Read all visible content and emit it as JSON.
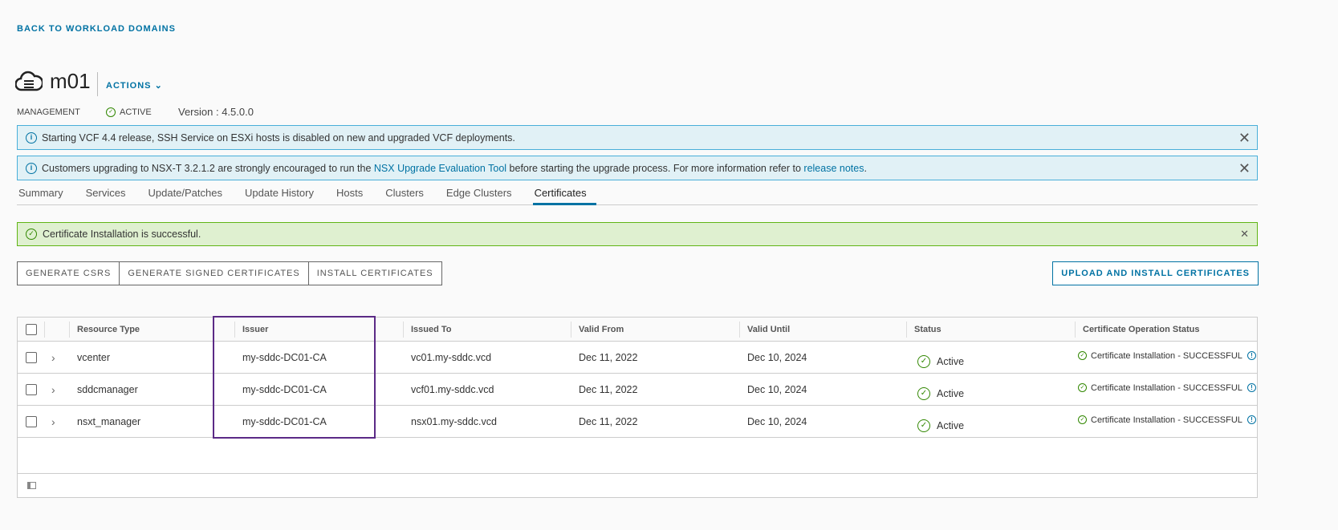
{
  "back_link": "BACK TO WORKLOAD DOMAINS",
  "domain": {
    "name": "m01",
    "actions": "ACTIONS",
    "type": "MANAGEMENT",
    "status": "ACTIVE",
    "version": "Version : 4.5.0.0"
  },
  "banners": [
    {
      "text": "Starting VCF 4.4 release, SSH Service on ESXi hosts is disabled on new and upgraded VCF deployments."
    },
    {
      "text_before": "Customers upgrading to NSX-T 3.2.1.2 are strongly encouraged to run the ",
      "link1": "NSX Upgrade Evaluation Tool",
      "text_middle": " before starting the upgrade process. For more information refer to ",
      "link2": "release notes",
      "text_after": "."
    }
  ],
  "tabs": [
    "Summary",
    "Services",
    "Update/Patches",
    "Update History",
    "Hosts",
    "Clusters",
    "Edge Clusters",
    "Certificates"
  ],
  "success_message": "Certificate Installation is successful.",
  "buttons": {
    "generate_csrs": "GENERATE CSRS",
    "generate_signed": "GENERATE SIGNED CERTIFICATES",
    "install": "INSTALL CERTIFICATES",
    "upload_install": "UPLOAD AND INSTALL CERTIFICATES"
  },
  "table": {
    "columns": [
      "Resource Type",
      "Issuer",
      "Issued To",
      "Valid From",
      "Valid Until",
      "Status",
      "Certificate Operation Status"
    ],
    "rows": [
      {
        "resource": "vcenter",
        "issuer": "my-sddc-DC01-CA",
        "issued_to": "vc01.my-sddc.vcd",
        "valid_from": "Dec 11, 2022",
        "valid_until": "Dec 10, 2024",
        "status": "Active",
        "op_status": "Certificate Installation - SUCCESSFUL"
      },
      {
        "resource": "sddcmanager",
        "issuer": "my-sddc-DC01-CA",
        "issued_to": "vcf01.my-sddc.vcd",
        "valid_from": "Dec 11, 2022",
        "valid_until": "Dec 10, 2024",
        "status": "Active",
        "op_status": "Certificate Installation - SUCCESSFUL"
      },
      {
        "resource": "nsxt_manager",
        "issuer": "my-sddc-DC01-CA",
        "issued_to": "nsx01.my-sddc.vcd",
        "valid_from": "Dec 11, 2022",
        "valid_until": "Dec 10, 2024",
        "status": "Active",
        "op_status": "Certificate Installation - SUCCESSFUL"
      }
    ]
  }
}
